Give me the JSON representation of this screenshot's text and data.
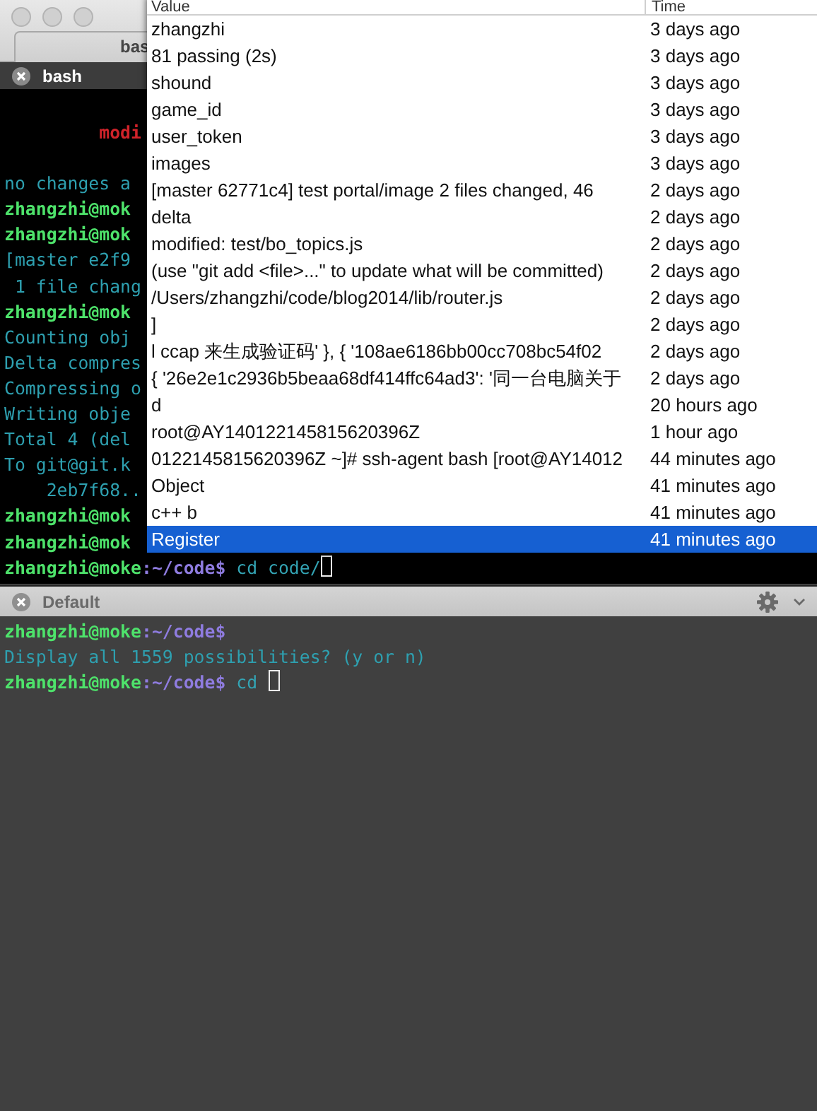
{
  "window": {
    "tab": "bas"
  },
  "panes": [
    {
      "title": "bash",
      "focused": true,
      "lines": [
        {
          "segments": [
            {
              "text": "         modi",
              "kind": "error"
            }
          ]
        },
        {
          "blank_before": true,
          "segments": [
            {
              "text": "no changes a",
              "kind": "output"
            }
          ]
        },
        {
          "segments": [
            {
              "text": "zhangzhi@mok",
              "kind": "prompt"
            }
          ]
        },
        {
          "segments": [
            {
              "text": "zhangzhi@mok",
              "kind": "prompt"
            }
          ]
        },
        {
          "segments": [
            {
              "text": "[master e2f9",
              "kind": "output"
            }
          ]
        },
        {
          "segments": [
            {
              "text": " 1 file chang",
              "kind": "output"
            }
          ]
        },
        {
          "segments": [
            {
              "text": "zhangzhi@mok",
              "kind": "prompt"
            }
          ]
        },
        {
          "segments": [
            {
              "text": "Counting obj",
              "kind": "output"
            }
          ]
        },
        {
          "segments": [
            {
              "text": "Delta compres",
              "kind": "output"
            }
          ]
        },
        {
          "segments": [
            {
              "text": "Compressing o",
              "kind": "output"
            }
          ]
        },
        {
          "segments": [
            {
              "text": "Writing obje",
              "kind": "output"
            }
          ]
        },
        {
          "segments": [
            {
              "text": "Total 4 (del",
              "kind": "output"
            }
          ]
        },
        {
          "segments": [
            {
              "text": "To git@git.k",
              "kind": "output"
            }
          ]
        },
        {
          "segments": [
            {
              "text": "    2eb7f68..",
              "kind": "output"
            }
          ]
        },
        {
          "segments": [
            {
              "text": "zhangzhi@mok",
              "kind": "prompt"
            }
          ]
        },
        {
          "segments": [
            {
              "text": "zhangzhi@mok",
              "kind": "prompt"
            }
          ]
        },
        {
          "cursor": true,
          "segments": [
            {
              "text": "zhangzhi@moke",
              "kind": "prompt"
            },
            {
              "text": ":~/code$",
              "kind": "path"
            },
            {
              "text": " cd code/",
              "kind": "command"
            }
          ]
        }
      ]
    },
    {
      "title": "Default",
      "focused": false,
      "lines": [
        {
          "segments": [
            {
              "text": "zhangzhi@moke",
              "kind": "prompt"
            },
            {
              "text": ":~/code$",
              "kind": "path"
            }
          ]
        },
        {
          "segments": [
            {
              "text": "Display all 1559 possibilities? (y or n)",
              "kind": "output"
            }
          ]
        },
        {
          "cursor": true,
          "segments": [
            {
              "text": "zhangzhi@moke",
              "kind": "prompt"
            },
            {
              "text": ":~/code$",
              "kind": "path"
            },
            {
              "text": " cd ",
              "kind": "command"
            }
          ]
        }
      ]
    }
  ],
  "popup": {
    "columns": [
      "Value",
      "Time"
    ],
    "rows": [
      {
        "value": "zhangzhi",
        "time": "3 days ago",
        "selected": false
      },
      {
        "value": "81 passing (2s)",
        "time": "3 days ago",
        "selected": false
      },
      {
        "value": "shound",
        "time": "3 days ago",
        "selected": false
      },
      {
        "value": "game_id",
        "time": "3 days ago",
        "selected": false
      },
      {
        "value": "user_token",
        "time": "3 days ago",
        "selected": false
      },
      {
        "value": "images",
        "time": "3 days ago",
        "selected": false
      },
      {
        "value": "[master 62771c4] test portal/image  2 files changed, 46",
        "time": "2 days ago",
        "selected": false
      },
      {
        "value": "delta",
        "time": "2 days ago",
        "selected": false
      },
      {
        "value": "modified:   test/bo_topics.js",
        "time": "2 days ago",
        "selected": false
      },
      {
        "value": "(use \"git add <file>...\" to update what will be committed)",
        "time": "2 days ago",
        "selected": false
      },
      {
        "value": "/Users/zhangzhi/code/blog2014/lib/router.js",
        "time": "2 days ago",
        "selected": false
      },
      {
        "value": "]",
        "time": "2 days ago",
        "selected": false
      },
      {
        "value": "l ccap 来生成验证码' },  { '108ae6186bb00cc708bc54f02",
        "time": "2 days ago",
        "selected": false
      },
      {
        "value": "{ '26e2e1c2936b5beaa68df414ffc64ad3': '同一台电脑关于",
        "time": "2 days ago",
        "selected": false
      },
      {
        "value": "d",
        "time": "20 hours ago",
        "selected": false
      },
      {
        "value": "root@AY140122145815620396Z",
        "time": "1 hour ago",
        "selected": false
      },
      {
        "value": "0122145815620396Z ~]# ssh-agent bash [root@AY14012",
        "time": "44 minutes ago",
        "selected": false
      },
      {
        "value": "Object",
        "time": "41 minutes ago",
        "selected": false
      },
      {
        "value": "c++ b",
        "time": "41 minutes ago",
        "selected": false
      },
      {
        "value": "Register",
        "time": "41 minutes ago",
        "selected": true
      }
    ]
  }
}
